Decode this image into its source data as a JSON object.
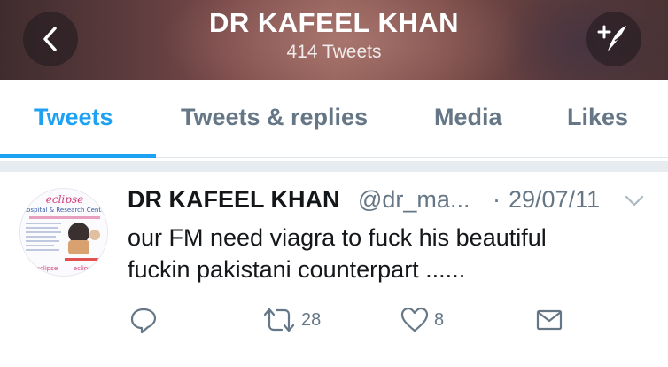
{
  "header": {
    "title": "DR KAFEEL KHAN",
    "subtitle": "414 Tweets"
  },
  "tabs": [
    {
      "label": "Tweets",
      "active": true
    },
    {
      "label": "Tweets & replies",
      "active": false
    },
    {
      "label": "Media",
      "active": false
    },
    {
      "label": "Likes",
      "active": false
    }
  ],
  "tweet": {
    "name": "DR KAFEEL KHAN",
    "handle": "@dr_ma...",
    "separator": "·",
    "date": "29/07/11",
    "text_lines": [
      "our FM need viagra to fuck his beautiful",
      "fuckin pakistani counterpart ......"
    ],
    "retweets": "28",
    "likes": "8"
  },
  "colors": {
    "accent": "#1da1f2",
    "muted": "#657786",
    "text": "#14171a"
  },
  "icons": [
    "back-arrow-icon",
    "compose-icon",
    "chevron-down-icon",
    "reply-icon",
    "retweet-icon",
    "heart-icon",
    "message-icon"
  ]
}
